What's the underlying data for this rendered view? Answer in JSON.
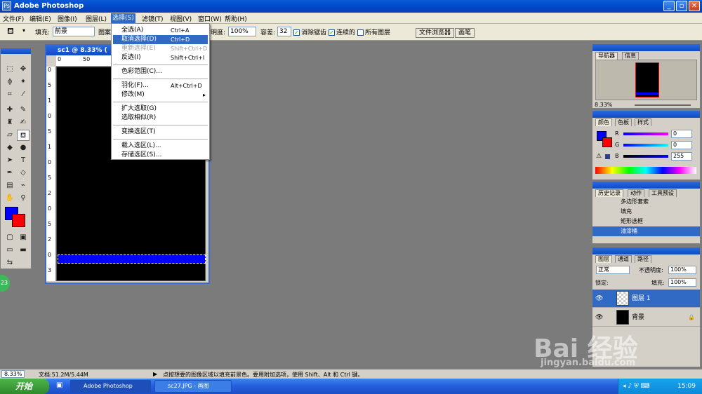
{
  "window": {
    "title": "Adobe Photoshop",
    "controls": [
      "_",
      "▫",
      "✕"
    ]
  },
  "menubar": [
    "文件(F)",
    "编辑(E)",
    "图像(I)",
    "图层(L)",
    "选择(S)",
    "滤镜(T)",
    "视图(V)",
    "窗口(W)",
    "帮助(H)"
  ],
  "options": {
    "fill_label": "填充:",
    "fill_value": "前景",
    "pattern_label": "图案",
    "opacity_label": "明度:",
    "opacity_value": "100%",
    "tolerance_label": "容差:",
    "tolerance_value": "32",
    "antialias_label": "消除锯齿",
    "contiguous_label": "连续的",
    "all_layers_label": "所有图层",
    "tab_file_browser": "文件浏览器",
    "tab_brushes": "画笔"
  },
  "document": {
    "title": "sc1 @ 8.33% (",
    "ruler_h": [
      "0",
      "50"
    ],
    "ruler_v": [
      "0",
      "5",
      "1",
      "0",
      "5",
      "1",
      "0",
      "5",
      "2",
      "0",
      "5",
      "2",
      "0",
      "3"
    ]
  },
  "select_menu": [
    {
      "label": "全选(A)",
      "shortcut": "Ctrl+A"
    },
    {
      "label": "取消选择(D)",
      "shortcut": "Ctrl+D"
    },
    {
      "label": "重新选择(E)",
      "shortcut": "Shift+Ctrl+D"
    },
    {
      "label": "反选(I)",
      "shortcut": "Shift+Ctrl+I"
    },
    {
      "label": "色彩范围(C)...",
      "shortcut": ""
    },
    {
      "label": "羽化(F)...",
      "shortcut": "Alt+Ctrl+D"
    },
    {
      "label": "修改(M)",
      "shortcut": "▸"
    },
    {
      "label": "扩大选取(G)",
      "shortcut": ""
    },
    {
      "label": "选取相似(R)",
      "shortcut": ""
    },
    {
      "label": "变换选区(T)",
      "shortcut": ""
    },
    {
      "label": "载入选区(L)...",
      "shortcut": ""
    },
    {
      "label": "存储选区(S)...",
      "shortcut": ""
    }
  ],
  "navigator": {
    "tabs": [
      "导航器",
      "信息"
    ],
    "zoom": "8.33%"
  },
  "color_panel": {
    "tabs": [
      "颜色",
      "色板",
      "样式"
    ],
    "channels": [
      {
        "name": "R",
        "value": "0"
      },
      {
        "name": "G",
        "value": "0"
      },
      {
        "name": "B",
        "value": "255"
      }
    ]
  },
  "history_panel": {
    "tabs": [
      "历史记录",
      "动作",
      "工具预设"
    ],
    "items": [
      "多边形套索",
      "填充",
      "矩形选框",
      "油漆桶"
    ]
  },
  "layers_panel": {
    "tabs": [
      "图层",
      "通道",
      "路径"
    ],
    "blend_mode": "正常",
    "opacity_label": "不透明度:",
    "opacity": "100%",
    "lock_label": "锁定:",
    "fill_label": "填充:",
    "fill": "100%",
    "layers": [
      "图层 1",
      "背景"
    ]
  },
  "status": {
    "zoom": "8.33%",
    "doc": "文档:51.2M/5.44M",
    "hint": "点按想要的图像区域以填充前景色。要用附加选项，使用 Shift、Alt 和 Ctrl 键。"
  },
  "taskbar": {
    "start": "开始",
    "tasks": [
      "Adobe Photoshop",
      "sc27.JPG - 画图"
    ],
    "clock": "15:09"
  },
  "watermark": {
    "brand": "Bai 经验",
    "url": "jingyan.baidu.com"
  },
  "colors": {
    "foreground": "#0000ff",
    "background": "#ff0000",
    "selection": "#0000ff"
  }
}
